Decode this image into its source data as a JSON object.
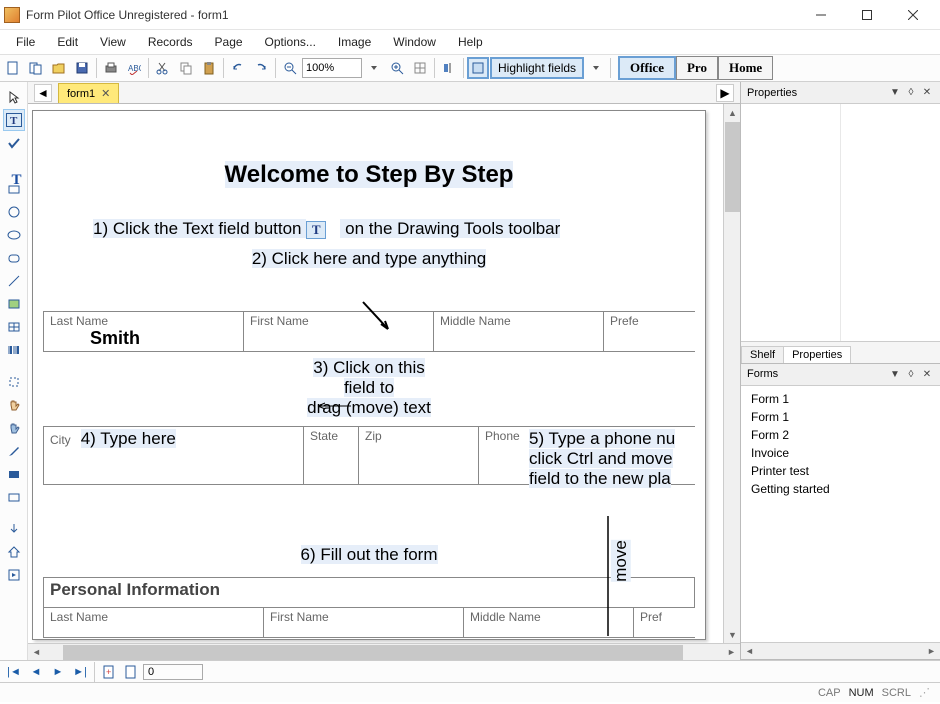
{
  "window": {
    "title": "Form Pilot Office Unregistered - form1"
  },
  "menu": {
    "items": [
      "File",
      "Edit",
      "View",
      "Records",
      "Page",
      "Options...",
      "Image",
      "Window",
      "Help"
    ]
  },
  "toolbar": {
    "zoom": "100%",
    "highlight_label": "Highlight fields",
    "modes": {
      "office": "Office",
      "pro": "Pro",
      "home": "Home"
    }
  },
  "tabs": {
    "doc1": "form1"
  },
  "document": {
    "heading": "Welcome to Step By Step",
    "step1_a": "1) Click the Text field button ",
    "step1_b": " on the Drawing Tools toolbar",
    "step2": "2) Click here and type anything",
    "table1": {
      "last_name_label": "Last Name",
      "last_name_value": "Smith",
      "first_name_label": "First Name",
      "middle_name_label": "Middle Name",
      "pref_label": "Prefe"
    },
    "step3_l1": "3) Click on this",
    "step3_l2": "field to",
    "step3_l3": "drag (move) text",
    "table2": {
      "city_label": "City",
      "city_value": "4) Type here",
      "state_label": "State",
      "zip_label": "Zip",
      "phone_label": "Phone"
    },
    "step5_l1": "5) Type a phone nu",
    "step5_l2": "click Ctrl and move",
    "step5_l3": "field to the new pla",
    "move_label": "move",
    "step6": "6) Fill out the form",
    "section2": "Personal Information",
    "table3": {
      "last_name_label": "Last Name",
      "first_name_label": "First Name",
      "middle_name_label": "Middle Name",
      "pref_label": "Pref"
    }
  },
  "panels": {
    "properties_title": "Properties",
    "shelf_tab": "Shelf",
    "properties_tab": "Properties",
    "forms_title": "Forms",
    "forms_items": [
      "Form 1",
      "Form 1",
      "Form 2",
      "Invoice",
      "Printer test",
      "Getting started"
    ]
  },
  "nav": {
    "page_num": "0"
  },
  "status": {
    "cap": "CAP",
    "num": "NUM",
    "scrl": "SCRL"
  }
}
